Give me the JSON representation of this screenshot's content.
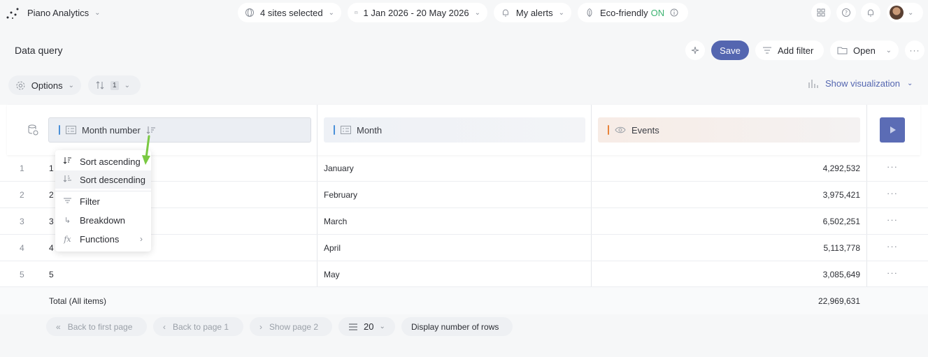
{
  "app": {
    "name": "Piano Analytics"
  },
  "topbar": {
    "sites": "4 sites selected",
    "dates": "1 Jan 2026 - 20 May 2026",
    "alerts": "My alerts",
    "eco_label": "Eco-friendly",
    "eco_status": "ON",
    "eco_color": "#3cb371"
  },
  "query": {
    "title": "Data query",
    "save": "Save",
    "add_filter": "Add filter",
    "open": "Open",
    "accent": "#5466b0"
  },
  "options": {
    "label": "Options",
    "sort_count": "1",
    "show_viz": "Show visualization"
  },
  "columns": [
    {
      "label": "Month number",
      "bar_color": "#4a90d9"
    },
    {
      "label": "Month",
      "bar_color": "#4a90d9"
    },
    {
      "label": "Events",
      "bar_color": "#e8833a"
    }
  ],
  "rows": [
    {
      "num": "1",
      "month_number": "1",
      "month": "January",
      "events": "4,292,532"
    },
    {
      "num": "2",
      "month_number": "2",
      "month": "February",
      "events": "3,975,421"
    },
    {
      "num": "3",
      "month_number": "3",
      "month": "March",
      "events": "6,502,251"
    },
    {
      "num": "4",
      "month_number": "4",
      "month": "April",
      "events": "5,113,778"
    },
    {
      "num": "5",
      "month_number": "5",
      "month": "May",
      "events": "3,085,649"
    }
  ],
  "total": {
    "label": "Total (All items)",
    "events": "22,969,631"
  },
  "menu": {
    "sort_asc": "Sort ascending",
    "sort_desc": "Sort descending",
    "filter": "Filter",
    "breakdown": "Breakdown",
    "functions": "Functions"
  },
  "footer": {
    "first_page": "Back to first page",
    "back_page": "Back to page 1",
    "show_page": "Show page 2",
    "rows_per_page": "20",
    "display_rows": "Display number of rows"
  }
}
